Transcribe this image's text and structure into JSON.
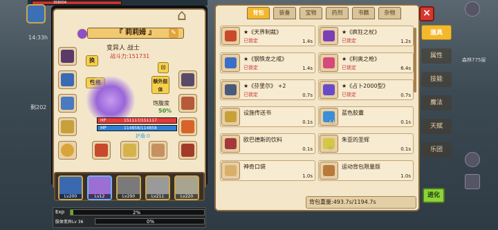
{
  "topbar": {
    "hp_label": "HP",
    "hp_value": "358004",
    "timer": "14:33h",
    "side_left_label": "剩202"
  },
  "character": {
    "name": "『 莉莉姆 』",
    "class_line": "变异人 战士",
    "power_label": "战斗力:",
    "power_value": "151731",
    "change_btn": "换",
    "personality_btn": "性格",
    "extra_body_btn": "额外肢体",
    "gear_btn": "⊡",
    "fatigue_label": "饱腹度",
    "fatigue_value": "50%",
    "hp_label": "HP",
    "hp_value": "151117/151117",
    "mp_label": "MP",
    "mp_value": "114858/114858",
    "shield_label": "护盾:0",
    "hp_color": "#e53a3a",
    "mp_color": "#2f7fd8"
  },
  "party": [
    {
      "level": "Lv200",
      "color": "#3b69b0"
    },
    {
      "level": "Lv12",
      "color": "#9b6fd4",
      "selected": true
    },
    {
      "level": "Lv290",
      "color": "#7a7a7a"
    },
    {
      "level": "Lv211",
      "color": "#9a9a9a"
    },
    {
      "level": "Lv220",
      "color": "#a9a48f"
    }
  ],
  "exp": {
    "label": "Exp",
    "percent": "2%",
    "fraction": 0.02,
    "sub_label": "肢体变异Lv 36",
    "sub_percent": "0%"
  },
  "inventory": {
    "tabs": [
      "背包",
      "装备",
      "宝物",
      "药剂",
      "书籍",
      "杂物"
    ],
    "active_tab": "背包",
    "items": [
      {
        "name": "★《天界制裁》",
        "locked": "已锁定",
        "weight": "1.4s",
        "color": "#c74a2a"
      },
      {
        "name": "★《疯狂之杖》",
        "locked": "已锁定",
        "weight": "1.2s",
        "color": "#7b3fb5"
      },
      {
        "name": "★《钢铁龙之戒》",
        "locked": "已锁定",
        "weight": "1.4s",
        "color": "#3b6fc7"
      },
      {
        "name": "★《利奥之枪》",
        "locked": "已锁定",
        "weight": "6.4s",
        "color": "#d44a7a"
      },
      {
        "name": "★《芬里尔》 +2",
        "locked": "已锁定",
        "weight": "0.7s",
        "color": "#4a5a7a"
      },
      {
        "name": "★《占卜2000型》",
        "locked": "已锁定",
        "weight": "0.7s",
        "color": "#6a4ac7"
      },
      {
        "name": "设施传送书",
        "locked": "",
        "weight": "0.1s",
        "color": "#c7a03a"
      },
      {
        "name": "蓝色胶囊",
        "locked": "",
        "weight": "0.1s",
        "color": "#3a8fd8",
        "count": "63"
      },
      {
        "name": "欧巴德斯的饮料",
        "locked": "",
        "weight": "0.1s",
        "color": "#a33a3a"
      },
      {
        "name": "朱亚的圣辉",
        "locked": "",
        "weight": "0.1s",
        "color": "#d4c74a",
        "count": "7"
      },
      {
        "name": "神奇口袋",
        "locked": "",
        "weight": "1.0s",
        "color": "#d8b06a"
      },
      {
        "name": "运动背包限量版",
        "locked": "",
        "weight": "1.0s",
        "color": "#b87a3a"
      }
    ],
    "capacity_label": "背包重量:",
    "capacity_value": "493.7s/1194.7s"
  },
  "side_menu": [
    "道具",
    "属性",
    "技能",
    "魔法",
    "天赋",
    "乐团"
  ],
  "side_menu_active": "道具",
  "evolve_btn": "进化",
  "right_info": "森林775层",
  "close_icon": "×"
}
